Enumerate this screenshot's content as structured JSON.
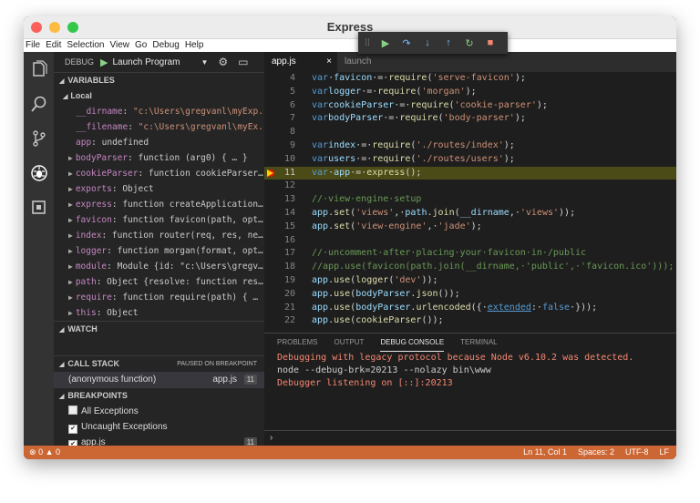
{
  "window": {
    "title": "Express"
  },
  "menu": [
    "File",
    "Edit",
    "Selection",
    "View",
    "Go",
    "Debug",
    "Help"
  ],
  "activity_icons": [
    "files-icon",
    "search-icon",
    "source-control-icon",
    "debug-icon",
    "extensions-icon"
  ],
  "debug": {
    "label": "DEBUG",
    "config": "Launch Program"
  },
  "variables": {
    "header": "VARIABLES",
    "scope": "Local",
    "items": [
      {
        "name": "__dirname",
        "value": "\"c:\\Users\\gregvanl\\myExp...",
        "expandable": false
      },
      {
        "name": "__filename",
        "value": "\"c:\\Users\\gregvanl\\myEx...",
        "expandable": false
      },
      {
        "name": "app",
        "value": "undefined",
        "expandable": false
      },
      {
        "name": "bodyParser",
        "value": "function (arg0) { … }",
        "expandable": true
      },
      {
        "name": "cookieParser",
        "value": "function cookieParser…",
        "expandable": true
      },
      {
        "name": "exports",
        "value": "Object",
        "expandable": true
      },
      {
        "name": "express",
        "value": "function createApplication…",
        "expandable": true
      },
      {
        "name": "favicon",
        "value": "function favicon(path, opt…",
        "expandable": true
      },
      {
        "name": "index",
        "value": "function router(req, res, ne…",
        "expandable": true
      },
      {
        "name": "logger",
        "value": "function morgan(format, opt…",
        "expandable": true
      },
      {
        "name": "module",
        "value": "Module {id: \"c:\\Users\\gregv…",
        "expandable": true
      },
      {
        "name": "path",
        "value": "Object {resolve: function res…",
        "expandable": true
      },
      {
        "name": "require",
        "value": "function require(path) { …",
        "expandable": true
      },
      {
        "name": "this",
        "value": "Object",
        "expandable": true
      }
    ]
  },
  "watch": {
    "header": "WATCH"
  },
  "callstack": {
    "header": "CALL STACK",
    "status": "PAUSED ON BREAKPOINT",
    "frame": {
      "name": "(anonymous function)",
      "file": "app.js",
      "line": "11"
    }
  },
  "breakpoints": {
    "header": "BREAKPOINTS",
    "items": [
      {
        "label": "All Exceptions",
        "checked": false,
        "line": ""
      },
      {
        "label": "Uncaught Exceptions",
        "checked": true,
        "line": ""
      },
      {
        "label": "app.js",
        "checked": true,
        "line": "11"
      }
    ]
  },
  "tabs": [
    {
      "label": "app.js",
      "close": "×",
      "active": true
    },
    {
      "label": "launch",
      "close": "",
      "active": false
    }
  ],
  "code_lines": [
    {
      "n": "4",
      "tokens": [
        [
          "kw",
          "var"
        ],
        [
          "",
          "·"
        ],
        [
          "id",
          "favicon"
        ],
        [
          "",
          "·=·"
        ],
        [
          "fn",
          "require"
        ],
        [
          "",
          "("
        ],
        [
          "str",
          "'serve-favicon'"
        ],
        [
          "",
          ");"
        ]
      ]
    },
    {
      "n": "5",
      "tokens": [
        [
          "kw",
          "var"
        ],
        [
          "",
          ""
        ],
        [
          "id",
          "logger"
        ],
        [
          "",
          "·=·"
        ],
        [
          "fn",
          "require"
        ],
        [
          "",
          "("
        ],
        [
          "str",
          "'morgan'"
        ],
        [
          "",
          ");"
        ]
      ]
    },
    {
      "n": "6",
      "tokens": [
        [
          "kw",
          "var"
        ],
        [
          "",
          ""
        ],
        [
          "id",
          "cookieParser"
        ],
        [
          "",
          "·=·"
        ],
        [
          "fn",
          "require"
        ],
        [
          "",
          "("
        ],
        [
          "str",
          "'cookie-parser'"
        ],
        [
          "",
          ");"
        ]
      ]
    },
    {
      "n": "7",
      "tokens": [
        [
          "kw",
          "var"
        ],
        [
          "",
          ""
        ],
        [
          "id",
          "bodyParser"
        ],
        [
          "",
          "·=·"
        ],
        [
          "fn",
          "require"
        ],
        [
          "",
          "("
        ],
        [
          "str",
          "'body-parser'"
        ],
        [
          "",
          ");"
        ]
      ]
    },
    {
      "n": "8",
      "tokens": []
    },
    {
      "n": "9",
      "tokens": [
        [
          "kw",
          "var"
        ],
        [
          "",
          ""
        ],
        [
          "id",
          "index"
        ],
        [
          "",
          "·=·"
        ],
        [
          "fn",
          "require"
        ],
        [
          "",
          "("
        ],
        [
          "str",
          "'./routes/index'"
        ],
        [
          "",
          ");"
        ]
      ]
    },
    {
      "n": "10",
      "tokens": [
        [
          "kw",
          "var"
        ],
        [
          "",
          ""
        ],
        [
          "id",
          "users"
        ],
        [
          "",
          "·=·"
        ],
        [
          "fn",
          "require"
        ],
        [
          "",
          "("
        ],
        [
          "str",
          "'./routes/users'"
        ],
        [
          "",
          ");"
        ]
      ]
    },
    {
      "n": "11",
      "tokens": [
        [
          "kw",
          "var"
        ],
        [
          "",
          "·"
        ],
        [
          "id",
          "app"
        ],
        [
          "",
          "·=·"
        ],
        [
          "fn",
          "express"
        ],
        [
          "",
          "();"
        ]
      ],
      "current": true
    },
    {
      "n": "12",
      "tokens": []
    },
    {
      "n": "13",
      "tokens": [
        [
          "cmt",
          "//·view·engine·setup"
        ]
      ]
    },
    {
      "n": "14",
      "tokens": [
        [
          "id",
          "app"
        ],
        [
          "",
          "."
        ],
        [
          "fn",
          "set"
        ],
        [
          "",
          "("
        ],
        [
          "str",
          "'views'"
        ],
        [
          "",
          ",·"
        ],
        [
          "id",
          "path"
        ],
        [
          "",
          "."
        ],
        [
          "fn",
          "join"
        ],
        [
          "",
          "("
        ],
        [
          "id",
          "__dirname"
        ],
        [
          "",
          ",·"
        ],
        [
          "str",
          "'views'"
        ],
        [
          "",
          "));"
        ]
      ]
    },
    {
      "n": "15",
      "tokens": [
        [
          "id",
          "app"
        ],
        [
          "",
          "."
        ],
        [
          "fn",
          "set"
        ],
        [
          "",
          "("
        ],
        [
          "str",
          "'view·engine'"
        ],
        [
          "",
          ",·"
        ],
        [
          "str",
          "'jade'"
        ],
        [
          "",
          ");"
        ]
      ]
    },
    {
      "n": "16",
      "tokens": []
    },
    {
      "n": "17",
      "tokens": [
        [
          "cmt",
          "//·uncomment·after·placing·your·favicon·in·/public"
        ]
      ]
    },
    {
      "n": "18",
      "tokens": [
        [
          "cmt",
          "//app.use(favicon(path.join(__dirname,·'public',·'favicon.ico')));"
        ]
      ]
    },
    {
      "n": "19",
      "tokens": [
        [
          "id",
          "app"
        ],
        [
          "",
          "."
        ],
        [
          "fn",
          "use"
        ],
        [
          "",
          "("
        ],
        [
          "fn",
          "logger"
        ],
        [
          "",
          "("
        ],
        [
          "str",
          "'dev'"
        ],
        [
          "",
          "));"
        ]
      ]
    },
    {
      "n": "20",
      "tokens": [
        [
          "id",
          "app"
        ],
        [
          "",
          "."
        ],
        [
          "fn",
          "use"
        ],
        [
          "",
          "("
        ],
        [
          "id",
          "bodyParser"
        ],
        [
          "",
          "."
        ],
        [
          "fn",
          "json"
        ],
        [
          "",
          "());"
        ]
      ]
    },
    {
      "n": "21",
      "tokens": [
        [
          "id",
          "app"
        ],
        [
          "",
          "."
        ],
        [
          "fn",
          "use"
        ],
        [
          "",
          "("
        ],
        [
          "id",
          "bodyParser"
        ],
        [
          "",
          "."
        ],
        [
          "fn",
          "urlencoded"
        ],
        [
          "",
          "({·"
        ],
        [
          "link",
          "extended"
        ],
        [
          "",
          ":·"
        ],
        [
          "kw",
          "false"
        ],
        [
          "",
          "·}));"
        ]
      ]
    },
    {
      "n": "22",
      "tokens": [
        [
          "id",
          "app"
        ],
        [
          "",
          "."
        ],
        [
          "fn",
          "use"
        ],
        [
          "",
          "("
        ],
        [
          "fn",
          "cookieParser"
        ],
        [
          "",
          "());"
        ]
      ]
    }
  ],
  "panel": {
    "tabs": [
      "PROBLEMS",
      "OUTPUT",
      "DEBUG CONSOLE",
      "TERMINAL"
    ],
    "active": "DEBUG CONSOLE",
    "console": [
      {
        "text": "Debugging with legacy protocol because Node v6.10.2 was detected.",
        "kind": "warn"
      },
      {
        "text": "node --debug-brk=20213 --nolazy bin\\www",
        "kind": "cmd"
      },
      {
        "text": "Debugger listening on [::]:20213",
        "kind": "warn"
      }
    ],
    "prompt": "›"
  },
  "status": {
    "errors": "0",
    "warnings": "0",
    "position": "Ln 11, Col 1",
    "spaces": "Spaces: 2",
    "encoding": "UTF-8",
    "eol": "LF"
  },
  "colors": {
    "statusbar": "#cc6633",
    "current_line": "#4b4b18",
    "breakpoint": "#e51400"
  }
}
